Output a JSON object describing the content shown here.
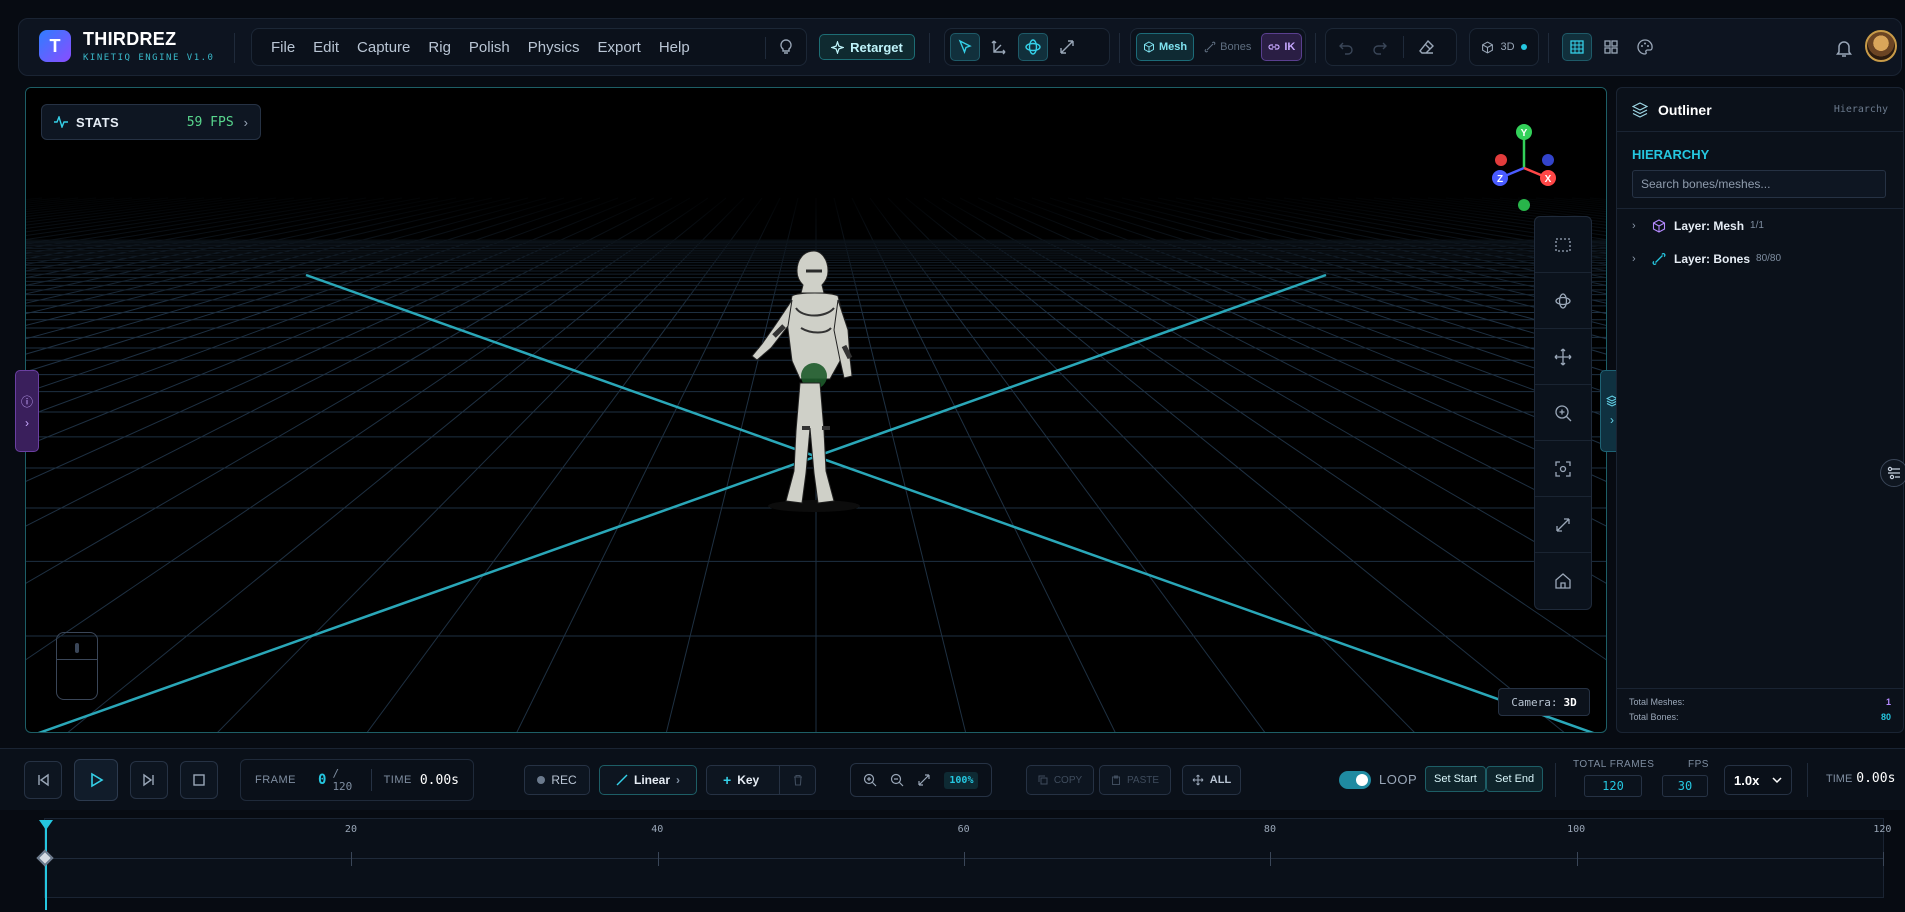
{
  "brand": {
    "name": "THIRDREZ",
    "subtitle": "KINETIQ ENGINE V1.0",
    "logo_letter": "T"
  },
  "menu": [
    "File",
    "Edit",
    "Capture",
    "Rig",
    "Polish",
    "Physics",
    "Export",
    "Help"
  ],
  "retarget_label": "Retarget",
  "modes": {
    "mesh": "Mesh",
    "bones": "Bones",
    "ik": "IK"
  },
  "view_mode": "3D",
  "stats": {
    "label": "STATS",
    "fps": "59 FPS"
  },
  "gizmo": {
    "y": "Y",
    "z": "Z",
    "x": "X"
  },
  "camera": {
    "label": "Camera:",
    "value": "3D"
  },
  "outliner": {
    "title": "Outliner",
    "subtitle": "Hierarchy",
    "section": "HIERARCHY",
    "search_placeholder": "Search bones/meshes...",
    "layers": [
      {
        "name": "Layer: Mesh",
        "count": "1/1"
      },
      {
        "name": "Layer: Bones",
        "count": "80/80"
      }
    ],
    "footer": {
      "meshes_label": "Total Meshes:",
      "meshes": "1",
      "bones_label": "Total Bones:",
      "bones": "80"
    }
  },
  "transport": {
    "frame_label": "FRAME",
    "frame": "0",
    "frame_total": "/ 120",
    "time_label": "TIME",
    "time": "0.00s",
    "rec": "REC",
    "interp": "Linear",
    "key": "Key",
    "zoom": "100%",
    "copy": "COPY",
    "paste": "PASTE",
    "all": "ALL",
    "loop": "LOOP",
    "set_start": "Set Start",
    "set_end": "Set End",
    "total_frames_label": "TOTAL FRAMES",
    "total_frames": "120",
    "fps_label": "FPS",
    "fps": "30",
    "speed": "1.0x",
    "time_right_label": "TIME",
    "time_right": "0.00s"
  },
  "timeline": {
    "ticks": [
      "20",
      "40",
      "60",
      "80",
      "100",
      "120"
    ],
    "playhead_frame": 0,
    "keyframes": [
      0
    ]
  },
  "colors": {
    "accent": "#25c7e0",
    "ik": "#c6a7ff",
    "fps": "#58d68d"
  }
}
